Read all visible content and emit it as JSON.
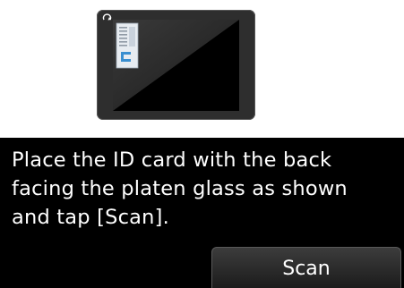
{
  "illustration": {
    "name": "scanner-platen-illustration",
    "card_icon": "id-card-icon",
    "corner_icon": "orientation-mark-icon"
  },
  "message": {
    "text": "Place the ID card with the back\nfacing the platen glass as shown\nand tap [Scan]."
  },
  "actions": {
    "scan_label": "Scan"
  },
  "colors": {
    "panel_background": "#000000",
    "text": "#ffffff",
    "scanner_body": "#2e2e2e",
    "card": "#dfe6ee",
    "card_accent": "#3a8fd0"
  }
}
